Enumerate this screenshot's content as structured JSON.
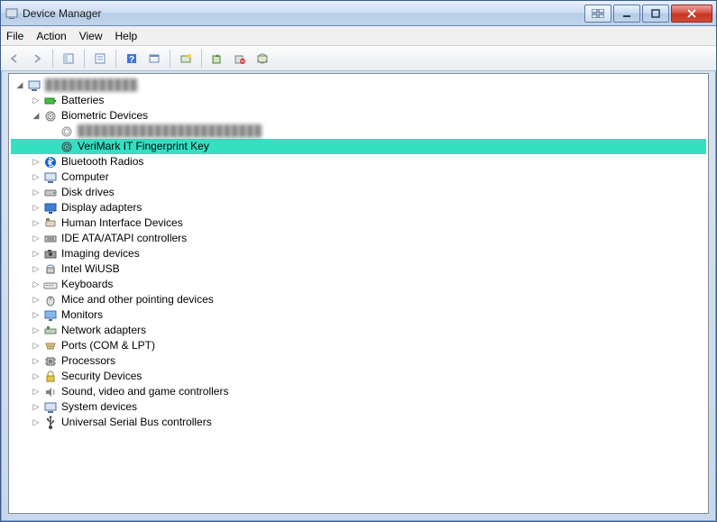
{
  "window": {
    "title": "Device Manager"
  },
  "menu": {
    "file": "File",
    "action": "Action",
    "view": "View",
    "help": "Help"
  },
  "tree": {
    "root_blurred": "████████████",
    "batteries": "Batteries",
    "biometric": "Biometric Devices",
    "biometric_child_blurred": "████████████████████████",
    "verimark": "VeriMark IT Fingerprint Key",
    "bluetooth": "Bluetooth Radios",
    "computer": "Computer",
    "disk": "Disk drives",
    "display": "Display adapters",
    "hid": "Human Interface Devices",
    "ide": "IDE ATA/ATAPI controllers",
    "imaging": "Imaging devices",
    "intelwiusb": "Intel WiUSB",
    "keyboards": "Keyboards",
    "mice": "Mice and other pointing devices",
    "monitors": "Monitors",
    "network": "Network adapters",
    "ports": "Ports (COM & LPT)",
    "processors": "Processors",
    "security": "Security Devices",
    "sound": "Sound, video and game controllers",
    "system": "System devices",
    "usb": "Universal Serial Bus controllers"
  }
}
